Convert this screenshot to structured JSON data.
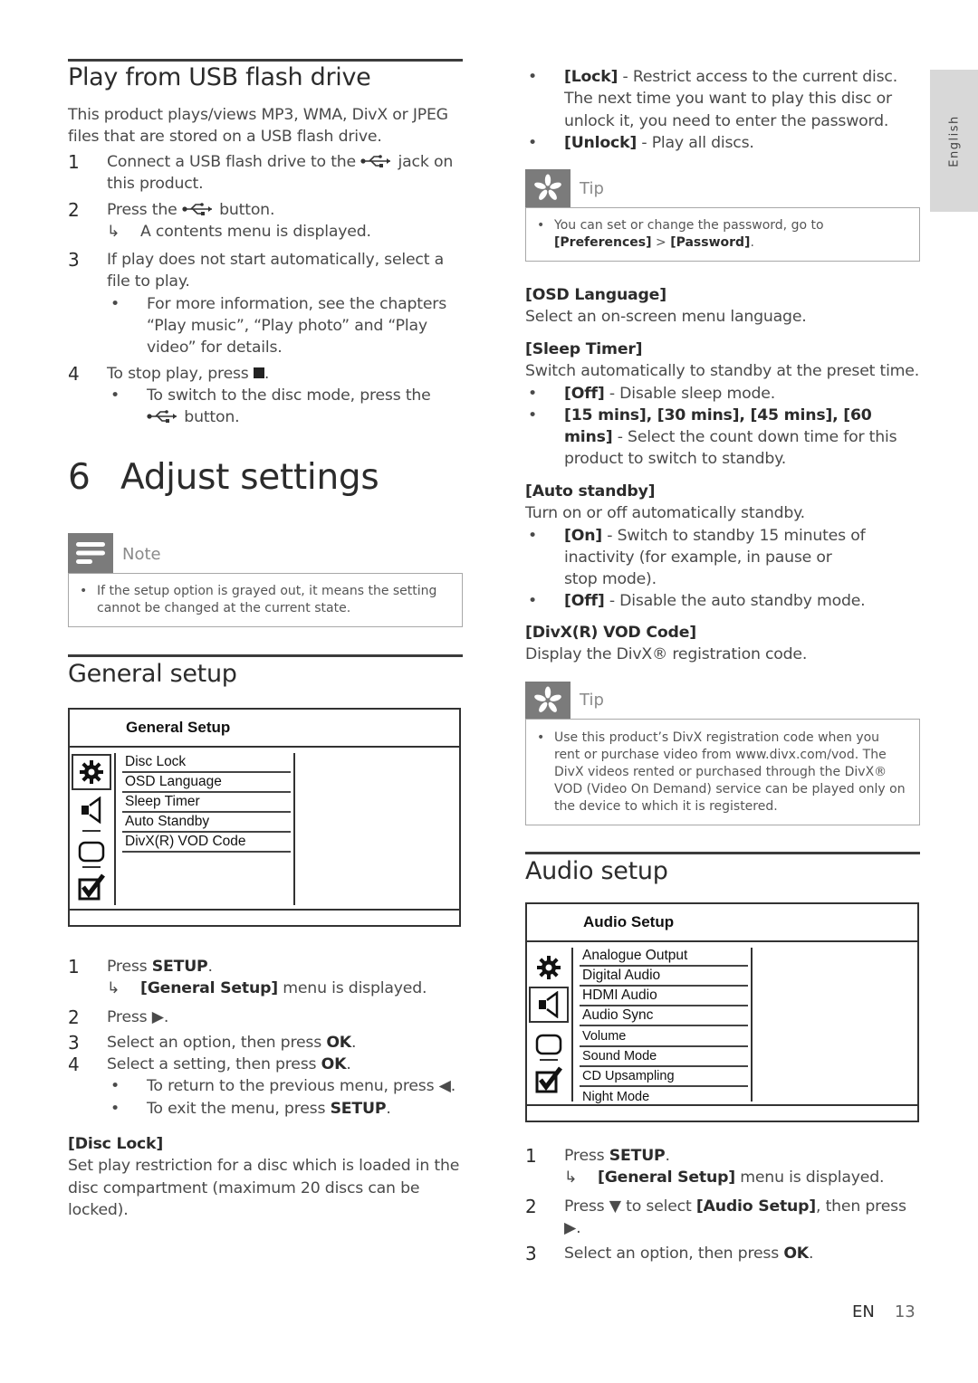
{
  "side_tab": {
    "label": "English"
  },
  "usb_section": {
    "title": "Play from USB flash drive",
    "intro": "This product plays/views MP3, WMA, DivX or JPEG files that are stored on a USB flash drive.",
    "steps": [
      {
        "num": "1",
        "text_before": "Connect a USB flash drive to the",
        "icon": "usb-icon",
        "text_after": "jack on this product."
      },
      {
        "num": "2",
        "text_before": "Press the",
        "icon": "usb-icon",
        "text_after": "button.",
        "result": "A contents menu is displayed."
      },
      {
        "num": "3",
        "text": "If play does not start automatically, select a file to play.",
        "bullet": "For more information, see the chapters “Play music”, “Play photo” and “Play video” for details."
      },
      {
        "num": "4",
        "text_before": "To stop play, press",
        "icon": "stop-icon",
        "text_after": ".",
        "bullet_before": "To switch to the disc mode, press the",
        "bullet_after": "button."
      }
    ]
  },
  "chapter": {
    "number": "6",
    "title": "Adjust settings"
  },
  "note": {
    "title": "Note",
    "text": "If the setup option is grayed out, it means the setting cannot be changed at the current state."
  },
  "general_setup": {
    "title": "General setup",
    "menu": {
      "title": "General Setup",
      "items": [
        "Disc Lock",
        "OSD Language",
        "Sleep Timer",
        "Auto Standby",
        "DivX(R) VOD Code"
      ],
      "icons": [
        "gear-icon",
        "speaker-icon",
        "display-icon",
        "checkbox-icon"
      ],
      "selected_icon": "gear-icon"
    },
    "steps": [
      {
        "num": "1",
        "text": "Press ",
        "bold": "SETUP",
        "end": ".",
        "result_bold": "[General Setup]",
        "result": " menu is displayed."
      },
      {
        "num": "2",
        "text": "Press ▶."
      },
      {
        "num": "3",
        "text": "Select an option, then press ",
        "bold": "OK",
        "end": "."
      },
      {
        "num": "4",
        "text": "Select a setting, then press ",
        "bold": "OK",
        "end": ".",
        "bullets": [
          {
            "text": "To return to the previous menu, press ◀."
          },
          {
            "text": "To exit the menu, press ",
            "bold": "SETUP",
            "end": "."
          }
        ]
      }
    ],
    "disc_lock": {
      "heading": "[Disc Lock]",
      "text": "Set play restriction for a disc which is loaded in the disc compartment (maximum 20 discs can be locked).",
      "options": [
        {
          "label": "[Lock]",
          "text": " - Restrict access to the current disc. The next time you want to play this disc or unlock it, you need to enter the password."
        },
        {
          "label": "[Unlock]",
          "text": " - Play all discs."
        }
      ]
    },
    "tip1": {
      "title": "Tip",
      "text_before": "You can set or change the password, go to ",
      "bold1": "[Preferences]",
      "mid": " > ",
      "bold2": "[Password]",
      "end": "."
    },
    "osd_language": {
      "heading": "[OSD Language]",
      "text": "Select an on-screen menu language."
    },
    "sleep_timer": {
      "heading": "[Sleep Timer]",
      "text": "Switch automatically to standby at the preset time.",
      "options": [
        {
          "label": "[Off]",
          "text": " - Disable sleep mode."
        },
        {
          "label": "[15 mins], [30 mins], [45 mins], [60 mins]",
          "text": " - Select the count down time for this product to switch to standby."
        }
      ]
    },
    "auto_standby": {
      "heading": "[Auto standby]",
      "text": "Turn on or off automatically standby.",
      "options": [
        {
          "label": "[On]",
          "text": " - Switch to standby 15 minutes of inactivity (for example, in pause or stop mode)."
        },
        {
          "label": "[Off]",
          "text": " - Disable the auto standby mode."
        }
      ]
    },
    "divx_code": {
      "heading": "[DivX(R) VOD Code]",
      "text": "Display the DivX® registration code."
    },
    "tip2": {
      "title": "Tip",
      "text": "Use this product’s DivX registration code when you rent or purchase video from www.divx.com/vod. The DivX videos rented or purchased through the DivX® VOD (Video On Demand) service can be played only on the device to which it is registered."
    }
  },
  "audio_setup": {
    "title": "Audio setup",
    "menu": {
      "title": "Audio Setup",
      "items": [
        "Analogue Output",
        "Digital Audio",
        "HDMI Audio",
        "Audio Sync",
        "Volume",
        "Sound Mode",
        "CD Upsampling",
        "Night Mode"
      ],
      "icons": [
        "gear-icon",
        "speaker-icon",
        "display-icon",
        "checkbox-icon"
      ],
      "selected_icon": "speaker-icon"
    },
    "steps": [
      {
        "num": "1",
        "text": "Press ",
        "bold": "SETUP",
        "end": ".",
        "result_bold": "[General Setup]",
        "result": " menu is displayed."
      },
      {
        "num": "2",
        "text": "Press ▼ to select ",
        "bold": "[Audio Setup]",
        "end": ", then press ▶."
      },
      {
        "num": "3",
        "text": "Select an option, then press ",
        "bold": "OK",
        "end": "."
      }
    ]
  },
  "footer": {
    "lang": "EN",
    "page": "13"
  }
}
